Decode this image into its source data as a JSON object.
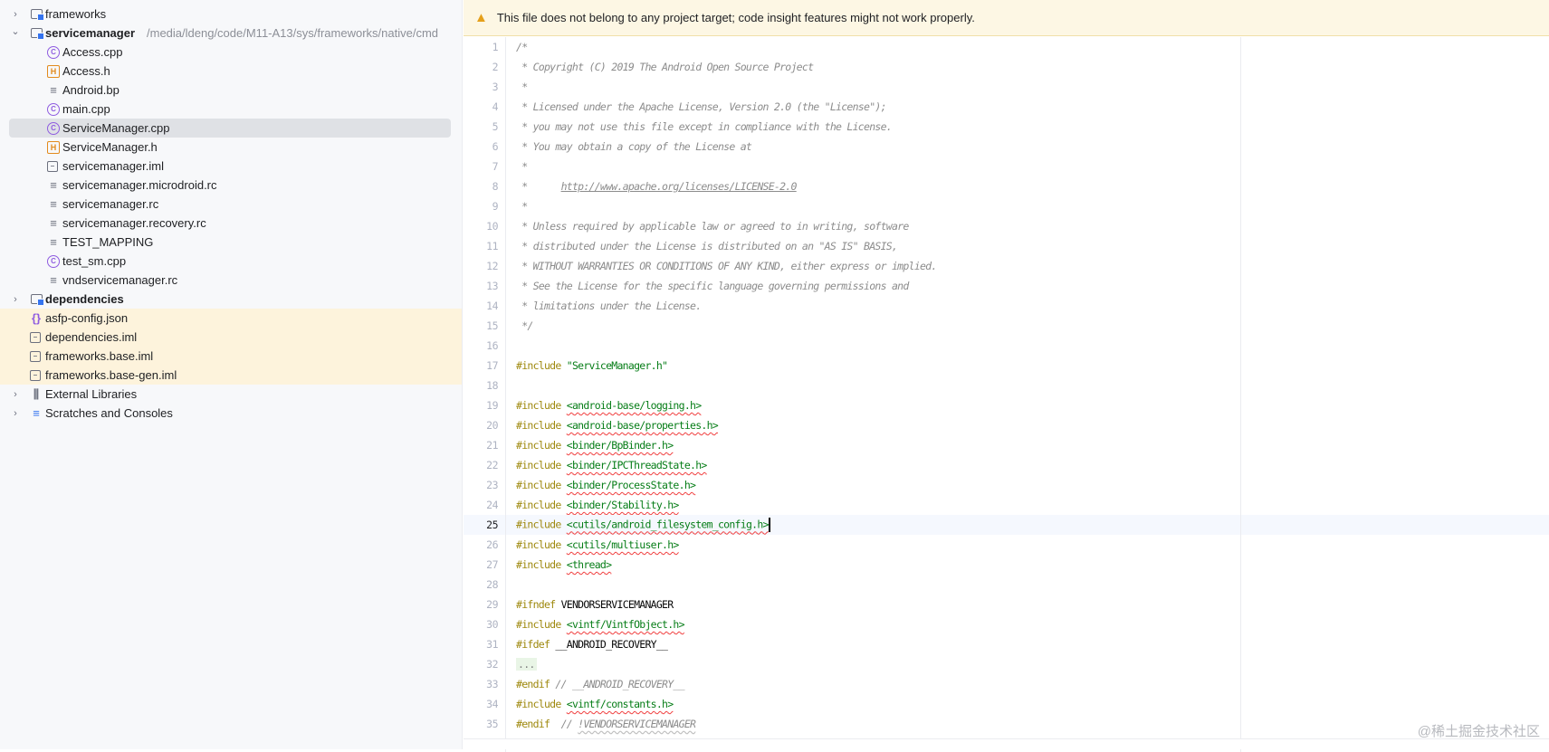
{
  "tree": [
    {
      "label": "frameworks",
      "level": 0,
      "chev": "›",
      "icon": "folder",
      "bold": false
    },
    {
      "label": "servicemanager",
      "level": 0,
      "chev": "⌄",
      "icon": "folder",
      "bold": true,
      "path": "/media/ldeng/code/M11-A13/sys/frameworks/native/cmd"
    },
    {
      "label": "Access.cpp",
      "level": 1,
      "icon": "cpp"
    },
    {
      "label": "Access.h",
      "level": 1,
      "icon": "h"
    },
    {
      "label": "Android.bp",
      "level": 1,
      "icon": "lines"
    },
    {
      "label": "main.cpp",
      "level": 1,
      "icon": "cpp"
    },
    {
      "label": "ServiceManager.cpp",
      "level": 1,
      "icon": "cpp",
      "selected": true
    },
    {
      "label": "ServiceManager.h",
      "level": 1,
      "icon": "h"
    },
    {
      "label": "servicemanager.iml",
      "level": 1,
      "icon": "iml"
    },
    {
      "label": "servicemanager.microdroid.rc",
      "level": 1,
      "icon": "lines"
    },
    {
      "label": "servicemanager.rc",
      "level": 1,
      "icon": "lines"
    },
    {
      "label": "servicemanager.recovery.rc",
      "level": 1,
      "icon": "lines"
    },
    {
      "label": "TEST_MAPPING",
      "level": 1,
      "icon": "lines"
    },
    {
      "label": "test_sm.cpp",
      "level": 1,
      "icon": "cpp"
    },
    {
      "label": "vndservicemanager.rc",
      "level": 1,
      "icon": "lines"
    },
    {
      "label": "dependencies",
      "level": 0,
      "chev": "›",
      "icon": "folder",
      "bold": true
    },
    {
      "label": "asfp-config.json",
      "level": 0,
      "icon": "json",
      "hl": true
    },
    {
      "label": "dependencies.iml",
      "level": 0,
      "icon": "iml",
      "hl": true
    },
    {
      "label": "frameworks.base.iml",
      "level": 0,
      "icon": "iml",
      "hl": true
    },
    {
      "label": "frameworks.base-gen.iml",
      "level": 0,
      "icon": "iml",
      "hl": true
    },
    {
      "label": "External Libraries",
      "level": 0,
      "chev": "›",
      "icon": "library"
    },
    {
      "label": "Scratches and Consoles",
      "level": 0,
      "chev": "›",
      "icon": "scratches"
    }
  ],
  "banner": {
    "icon": "warning-icon",
    "text": "This file does not belong to any project target; code insight features might not work properly."
  },
  "editor": {
    "current_line": 25,
    "lines": [
      [
        [
          "cm",
          "/*"
        ]
      ],
      [
        [
          "cm",
          " * Copyright (C) 2019 The Android Open Source Project"
        ]
      ],
      [
        [
          "cm",
          " *"
        ]
      ],
      [
        [
          "cm",
          " * Licensed under the Apache License, Version 2.0 (the \"License\");"
        ]
      ],
      [
        [
          "cm",
          " * you may not use this file except in compliance with the License."
        ]
      ],
      [
        [
          "cm",
          " * You may obtain a copy of the License at"
        ]
      ],
      [
        [
          "cm",
          " *"
        ]
      ],
      [
        [
          "cm",
          " *      "
        ],
        [
          "link",
          "http://www.apache.org/licenses/LICENSE-2.0"
        ]
      ],
      [
        [
          "cm",
          " *"
        ]
      ],
      [
        [
          "cm",
          " * Unless required by applicable law or agreed to in writing, software"
        ]
      ],
      [
        [
          "cm",
          " * distributed under the License is distributed on an \"AS IS\" BASIS,"
        ]
      ],
      [
        [
          "cm",
          " * WITHOUT WARRANTIES OR CONDITIONS OF ANY KIND, either express or implied."
        ]
      ],
      [
        [
          "cm",
          " * See the License for the specific language governing permissions and"
        ]
      ],
      [
        [
          "cm",
          " * limitations under the License."
        ]
      ],
      [
        [
          "cm",
          " */"
        ]
      ],
      [],
      [
        [
          "kw",
          "#include "
        ],
        [
          "str",
          "\"ServiceManager.h\""
        ]
      ],
      [],
      [
        [
          "kw",
          "#include "
        ],
        [
          "inc",
          "<android-base/logging.h>"
        ]
      ],
      [
        [
          "kw",
          "#include "
        ],
        [
          "inc",
          "<android-base/properties.h>"
        ]
      ],
      [
        [
          "kw",
          "#include "
        ],
        [
          "inc",
          "<binder/BpBinder.h>"
        ]
      ],
      [
        [
          "kw",
          "#include "
        ],
        [
          "inc",
          "<binder/IPCThreadState.h>"
        ]
      ],
      [
        [
          "kw",
          "#include "
        ],
        [
          "inc",
          "<binder/ProcessState.h>"
        ]
      ],
      [
        [
          "kw",
          "#include "
        ],
        [
          "inc",
          "<binder/Stability.h>"
        ]
      ],
      [
        [
          "kw",
          "#include "
        ],
        [
          "inc",
          "<cutils/android_filesystem_config.h>"
        ]
      ],
      [
        [
          "kw",
          "#include "
        ],
        [
          "inc",
          "<cutils/multiuser.h>"
        ]
      ],
      [
        [
          "kw",
          "#include "
        ],
        [
          "inc",
          "<thread>"
        ]
      ],
      [],
      [
        [
          "kw",
          "#ifndef "
        ],
        [
          "pl",
          "VENDORSERVICEMANAGER"
        ]
      ],
      [
        [
          "kw",
          "#include "
        ],
        [
          "inc",
          "<vintf/VintfObject.h>"
        ]
      ],
      [
        [
          "kw",
          "#ifdef "
        ],
        [
          "pl",
          "__ANDROID_RECOVERY__"
        ]
      ],
      [
        [
          "fold",
          "..."
        ]
      ],
      [
        [
          "kw",
          "#endif "
        ],
        [
          "cm",
          "// __ANDROID_RECOVERY__"
        ]
      ],
      [
        [
          "kw",
          "#include "
        ],
        [
          "inc",
          "<vintf/constants.h>"
        ]
      ],
      [
        [
          "kw",
          "#endif  "
        ],
        [
          "cm",
          "// "
        ],
        [
          "incc",
          "!VENDORSERVICEMANAGER"
        ]
      ]
    ]
  },
  "watermark": "@稀土掘金技术社区"
}
